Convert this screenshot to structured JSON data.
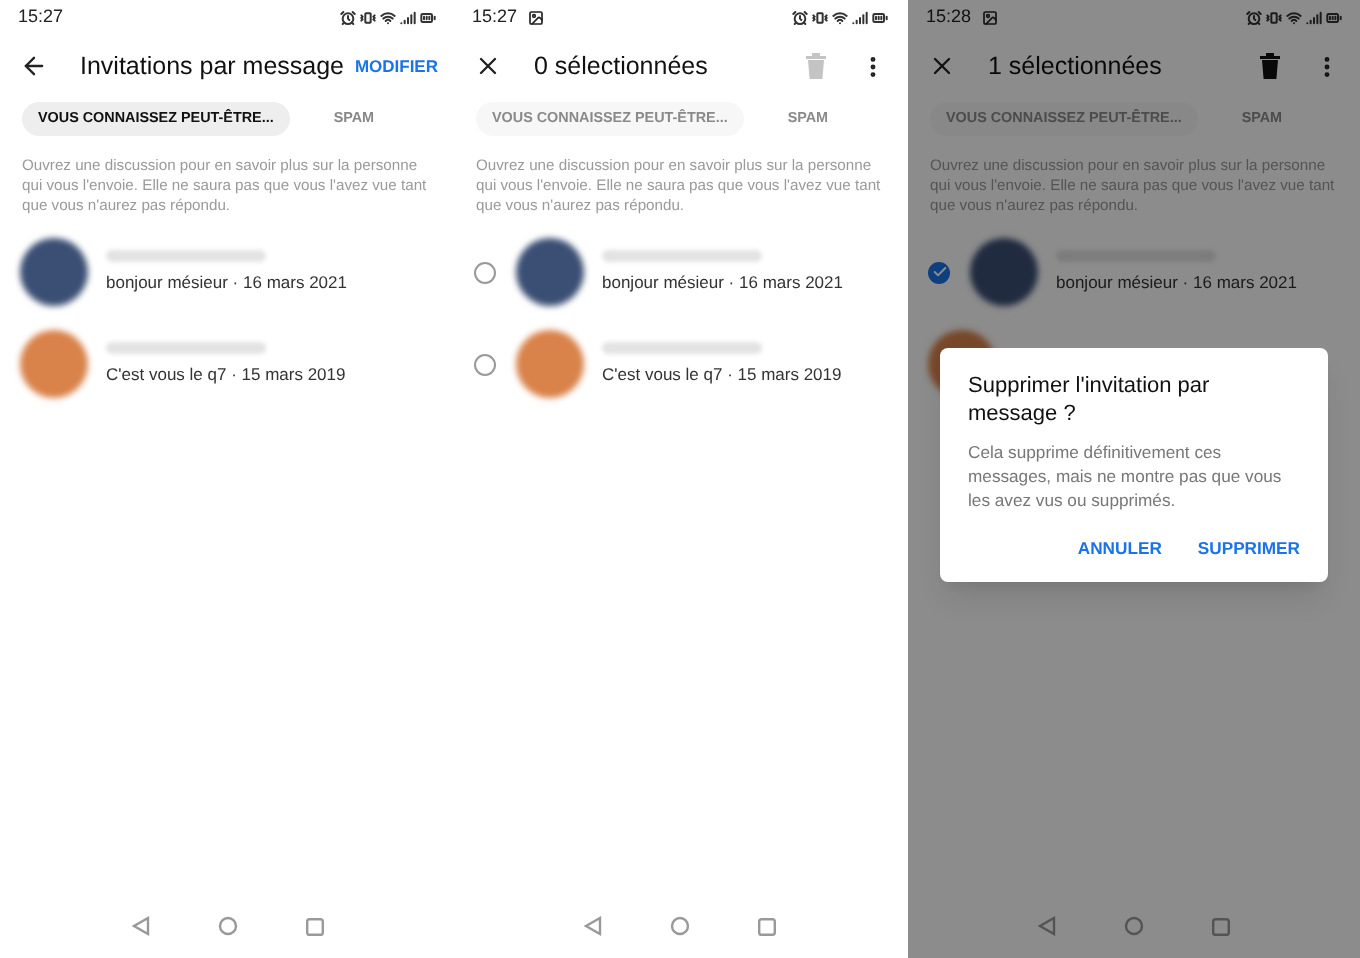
{
  "screens": [
    {
      "selecting": false,
      "status_bar": {
        "time": "15:27",
        "gallery_icon": false
      },
      "title": "Invitations par message",
      "action_label": "MODIFIER",
      "tabs_disabled": false,
      "tabs": [
        {
          "label": "VOUS CONNAISSEZ PEUT-ÊTRE...",
          "selected": true
        },
        {
          "label": "SPAM",
          "selected": false
        }
      ],
      "notice": "Ouvrez une discussion pour en savoir plus sur la personne qui vous l'envoie. Elle ne saura pas que vous l'avez vue tant que vous n'aurez pas répondu.",
      "conversations": [
        {
          "color": "#3b4f74",
          "preview": "bonjour mésieur · 16 mars 2021"
        },
        {
          "color": "#d9824a",
          "preview": "C'est vous le q7 · 15 mars 2019"
        }
      ]
    },
    {
      "selecting": true,
      "status_bar": {
        "time": "15:27",
        "gallery_icon": true
      },
      "title": "0 sélectionnées",
      "trash_enabled": false,
      "tabs_disabled": true,
      "tabs": [
        {
          "label": "VOUS CONNAISSEZ PEUT-ÊTRE...",
          "selected": true
        },
        {
          "label": "SPAM",
          "selected": false
        }
      ],
      "notice": "Ouvrez une discussion pour en savoir plus sur la personne qui vous l'envoie. Elle ne saura pas que vous l'avez vue tant que vous n'aurez pas répondu.",
      "conversations": [
        {
          "color": "#3b4f74",
          "preview": "bonjour mésieur · 16 mars 2021",
          "selected": false
        },
        {
          "color": "#d9824a",
          "preview": "C'est vous le q7 · 15 mars 2019",
          "selected": false
        }
      ]
    },
    {
      "selecting": true,
      "status_bar": {
        "time": "15:28",
        "gallery_icon": true
      },
      "title": "1 sélectionnées",
      "trash_enabled": true,
      "tabs_disabled": true,
      "tabs": [
        {
          "label": "VOUS CONNAISSEZ PEUT-ÊTRE...",
          "selected": true
        },
        {
          "label": "SPAM",
          "selected": false
        }
      ],
      "notice": "Ouvrez une discussion pour en savoir plus sur la personne qui vous l'envoie. Elle ne saura pas que vous l'avez vue tant que vous n'aurez pas répondu.",
      "conversations": [
        {
          "color": "#202b40",
          "preview": "bonjour mésieur · 16 mars 2021",
          "selected": true
        },
        {
          "color": "#774729"
        }
      ],
      "dialog": {
        "title": "Supprimer l'invitation par message ?",
        "body": "Cela supprime définitivement ces messages, mais ne montre pas que vous les avez vus ou supprimés.",
        "buttons": [
          "ANNULER",
          "SUPPRIMER"
        ]
      }
    }
  ]
}
